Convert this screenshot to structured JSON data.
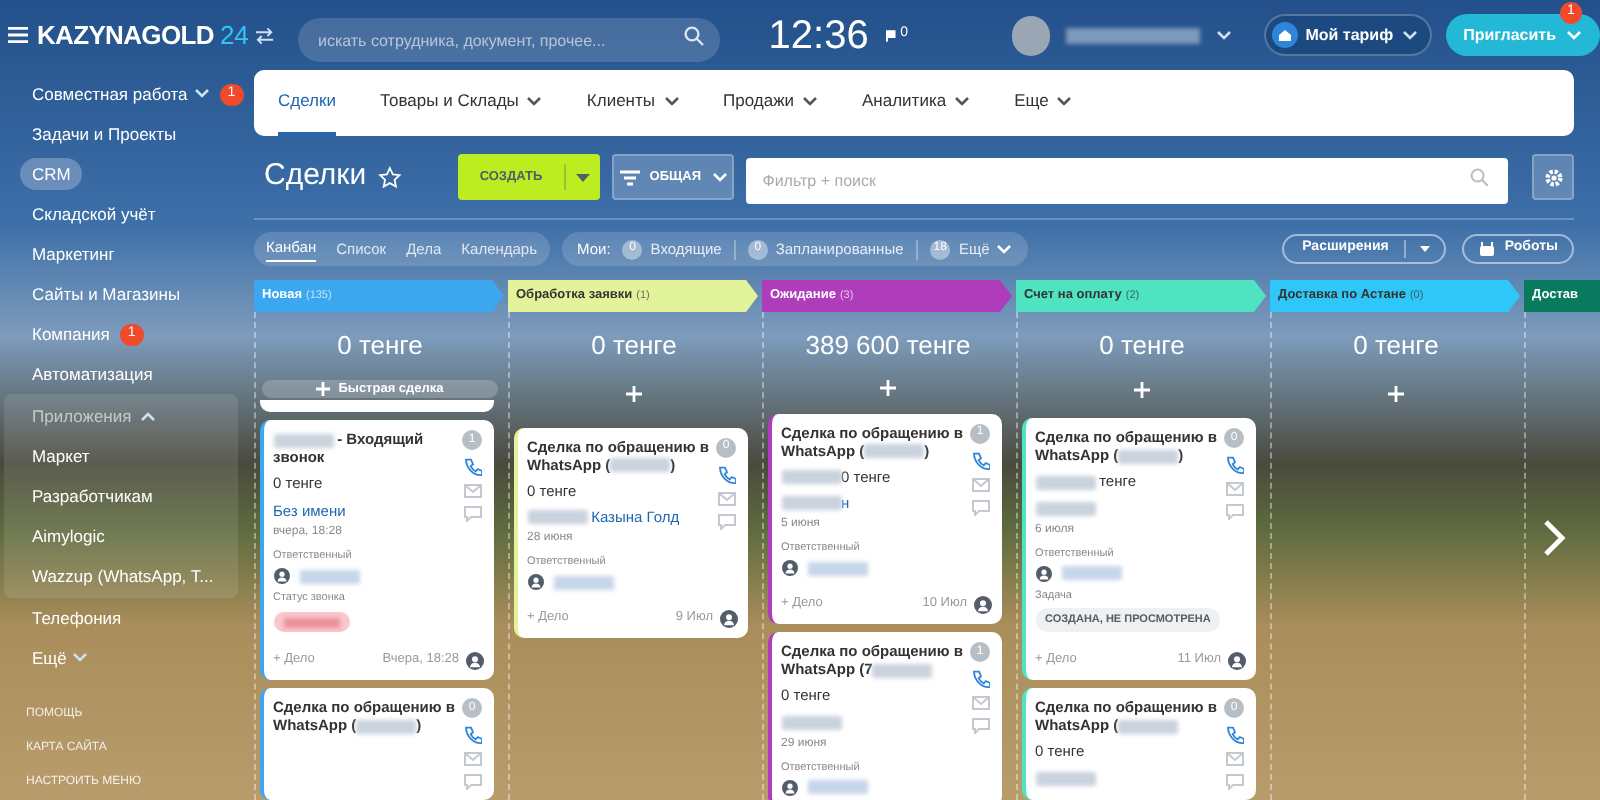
{
  "header": {
    "logo": "KAZYNAGOLD",
    "logo_suffix": "24",
    "search": {
      "placeholder": "искать сотрудника, документ, прочее..."
    },
    "clock": "12:36",
    "flag_count": "0",
    "tariff_button": "Мой тариф",
    "invite_button": "Пригласить",
    "invite_badge": "1"
  },
  "sidebar": {
    "items": [
      {
        "label": "Совместная работа",
        "badge": "1",
        "chevron": true,
        "selected": false
      },
      {
        "label": "Задачи и Проекты",
        "selected": false
      },
      {
        "label": "CRM",
        "selected": true
      },
      {
        "label": "Складской учёт",
        "selected": false
      },
      {
        "label": "Маркетинг",
        "selected": false
      },
      {
        "label": "Сайты и Магазины",
        "selected": false
      },
      {
        "label": "Компания",
        "badge": "1",
        "selected": false
      },
      {
        "label": "Автоматизация",
        "selected": false
      },
      {
        "label": "Приложения",
        "kind": "group",
        "expanded": true,
        "children": [
          {
            "label": "Маркет",
            "selected": false
          },
          {
            "label": "Разработчикам",
            "selected": false
          },
          {
            "label": "Aimylogic",
            "selected": false
          },
          {
            "label": "Wazzup (WhatsApp, T...",
            "selected": false
          }
        ]
      },
      {
        "label": "Телефония",
        "selected": false
      },
      {
        "label": "Ещё",
        "chevron": true,
        "selected": false
      }
    ],
    "footer": [
      "ПОМОЩЬ",
      "КАРТА САЙТА",
      "НАСТРОИТЬ МЕНЮ"
    ]
  },
  "nav": {
    "tabs": [
      {
        "label": "Сделки",
        "selected": true,
        "dropdown": false
      },
      {
        "label": "Товары и Склады",
        "selected": false,
        "dropdown": true
      },
      {
        "label": "Клиенты",
        "selected": false,
        "dropdown": true
      },
      {
        "label": "Продажи",
        "selected": false,
        "dropdown": true
      },
      {
        "label": "Аналитика",
        "selected": false,
        "dropdown": true
      },
      {
        "label": "Еще",
        "selected": false,
        "dropdown": true
      }
    ]
  },
  "toolbar": {
    "title": "Сделки",
    "create_button": "СОЗДАТЬ",
    "filter_button": "ОБЩАЯ",
    "filter": {
      "placeholder": "Фильтр + поиск"
    }
  },
  "views": {
    "tabs": [
      {
        "label": "Канбан",
        "selected": true
      },
      {
        "label": "Список",
        "selected": false
      },
      {
        "label": "Дела",
        "selected": false
      },
      {
        "label": "Календарь",
        "selected": false
      }
    ],
    "my_label": "Мои:",
    "counters": [
      {
        "count": "0",
        "label": "Входящие"
      },
      {
        "count": "0",
        "label": "Запланированные"
      },
      {
        "count": "18",
        "label": "Ещё"
      }
    ],
    "extensions_button": "Расширения",
    "robots_button": "Роботы"
  },
  "columns": [
    {
      "title": "Новая",
      "count": "(135)",
      "color": "#3aa7ee",
      "sum": "0 тенге",
      "quick_add": "Быстрая сделка",
      "stub_above": true,
      "cards": [
        {
          "title": [
            {
              "kind": "blur"
            },
            {
              "kind": "text",
              "text": " - Входящий звонок"
            }
          ],
          "counter": "1",
          "amount": [
            {
              "kind": "text",
              "text": "0 тенге"
            }
          ],
          "link": [
            {
              "kind": "text",
              "text": "Без имени"
            }
          ],
          "date": "вчера, 18:28",
          "fields": [
            {
              "label": "Ответственный",
              "kind": "person"
            },
            {
              "label": "Статус звонка",
              "kind": "status"
            }
          ],
          "action": "+ Дело",
          "footer_date": "Вчера, 18:28"
        },
        {
          "title": [
            {
              "kind": "text",
              "text": "Сделка по обращению в WhatsApp ("
            },
            {
              "kind": "blur"
            },
            {
              "kind": "text",
              "text": ")"
            }
          ],
          "counter": "0"
        }
      ]
    },
    {
      "title": "Обработка заявки",
      "count": "(1)",
      "color": "#e3f39b",
      "sum": "0 тенге",
      "cards": [
        {
          "title": [
            {
              "kind": "text",
              "text": "Сделка по обращению в WhatsApp ("
            },
            {
              "kind": "blur"
            },
            {
              "kind": "text",
              "text": ")"
            }
          ],
          "counter": "0",
          "amount": [
            {
              "kind": "text",
              "text": "0 тенге"
            }
          ],
          "link": [
            {
              "kind": "blur"
            },
            {
              "kind": "text",
              "text": " Казына Голд"
            }
          ],
          "date": "28 июня",
          "fields": [
            {
              "label": "Ответственный",
              "kind": "person"
            }
          ],
          "action": "+ Дело",
          "footer_date": "9 Июл"
        }
      ]
    },
    {
      "title": "Ожидание",
      "count": "(3)",
      "color": "#ae3cbb",
      "sum": "389 600 тенге",
      "cards": [
        {
          "title": [
            {
              "kind": "text",
              "text": "Сделка по обращению в WhatsApp ("
            },
            {
              "kind": "blur"
            },
            {
              "kind": "text",
              "text": ")"
            }
          ],
          "counter": "1",
          "amount": [
            {
              "kind": "blur"
            },
            {
              "kind": "text",
              "text": "0 тенге"
            }
          ],
          "link": [
            {
              "kind": "blur"
            },
            {
              "kind": "text",
              "text": "н"
            }
          ],
          "date": "5 июня",
          "fields": [
            {
              "label": "Ответственный",
              "kind": "person"
            }
          ],
          "action": "+ Дело",
          "footer_date": "10 Июл"
        },
        {
          "title": [
            {
              "kind": "text",
              "text": "Сделка по обращению в WhatsApp (7"
            },
            {
              "kind": "blur"
            }
          ],
          "counter": "1",
          "amount": [
            {
              "kind": "text",
              "text": "0 тенге"
            }
          ],
          "link": [
            {
              "kind": "blur"
            }
          ],
          "date": "29 июня",
          "fields": [
            {
              "label": "Ответственный",
              "kind": "person"
            }
          ]
        }
      ]
    },
    {
      "title": "Счет на оплату",
      "count": "(2)",
      "color": "#4fe3c1",
      "sum": "0 тенге",
      "cards": [
        {
          "title": [
            {
              "kind": "text",
              "text": "Сделка по обращению в WhatsApp ("
            },
            {
              "kind": "blur"
            },
            {
              "kind": "text",
              "text": ")"
            }
          ],
          "counter": "0",
          "amount": [
            {
              "kind": "blur"
            },
            {
              "kind": "text",
              "text": " тенге"
            }
          ],
          "link": [
            {
              "kind": "blur"
            }
          ],
          "date": "6 июля",
          "fields": [
            {
              "label": "Ответственный",
              "kind": "person"
            },
            {
              "label": "Задача",
              "kind": "tag",
              "value": "СОЗДАНА, НЕ ПРОСМОТРЕНА"
            }
          ],
          "action": "+ Дело",
          "footer_date": "11 Июл"
        },
        {
          "title": [
            {
              "kind": "text",
              "text": "Сделка по обращению в WhatsApp ("
            },
            {
              "kind": "blur"
            }
          ],
          "counter": "0",
          "amount": [
            {
              "kind": "text",
              "text": "0 тенге"
            }
          ],
          "link": [
            {
              "kind": "blur"
            }
          ]
        }
      ]
    },
    {
      "title": "Доставка по Астане",
      "count": "(0)",
      "color": "#2fc7f7",
      "sum": "0 тенге"
    },
    {
      "title": "Достав",
      "color": "#0a7a5f"
    }
  ]
}
